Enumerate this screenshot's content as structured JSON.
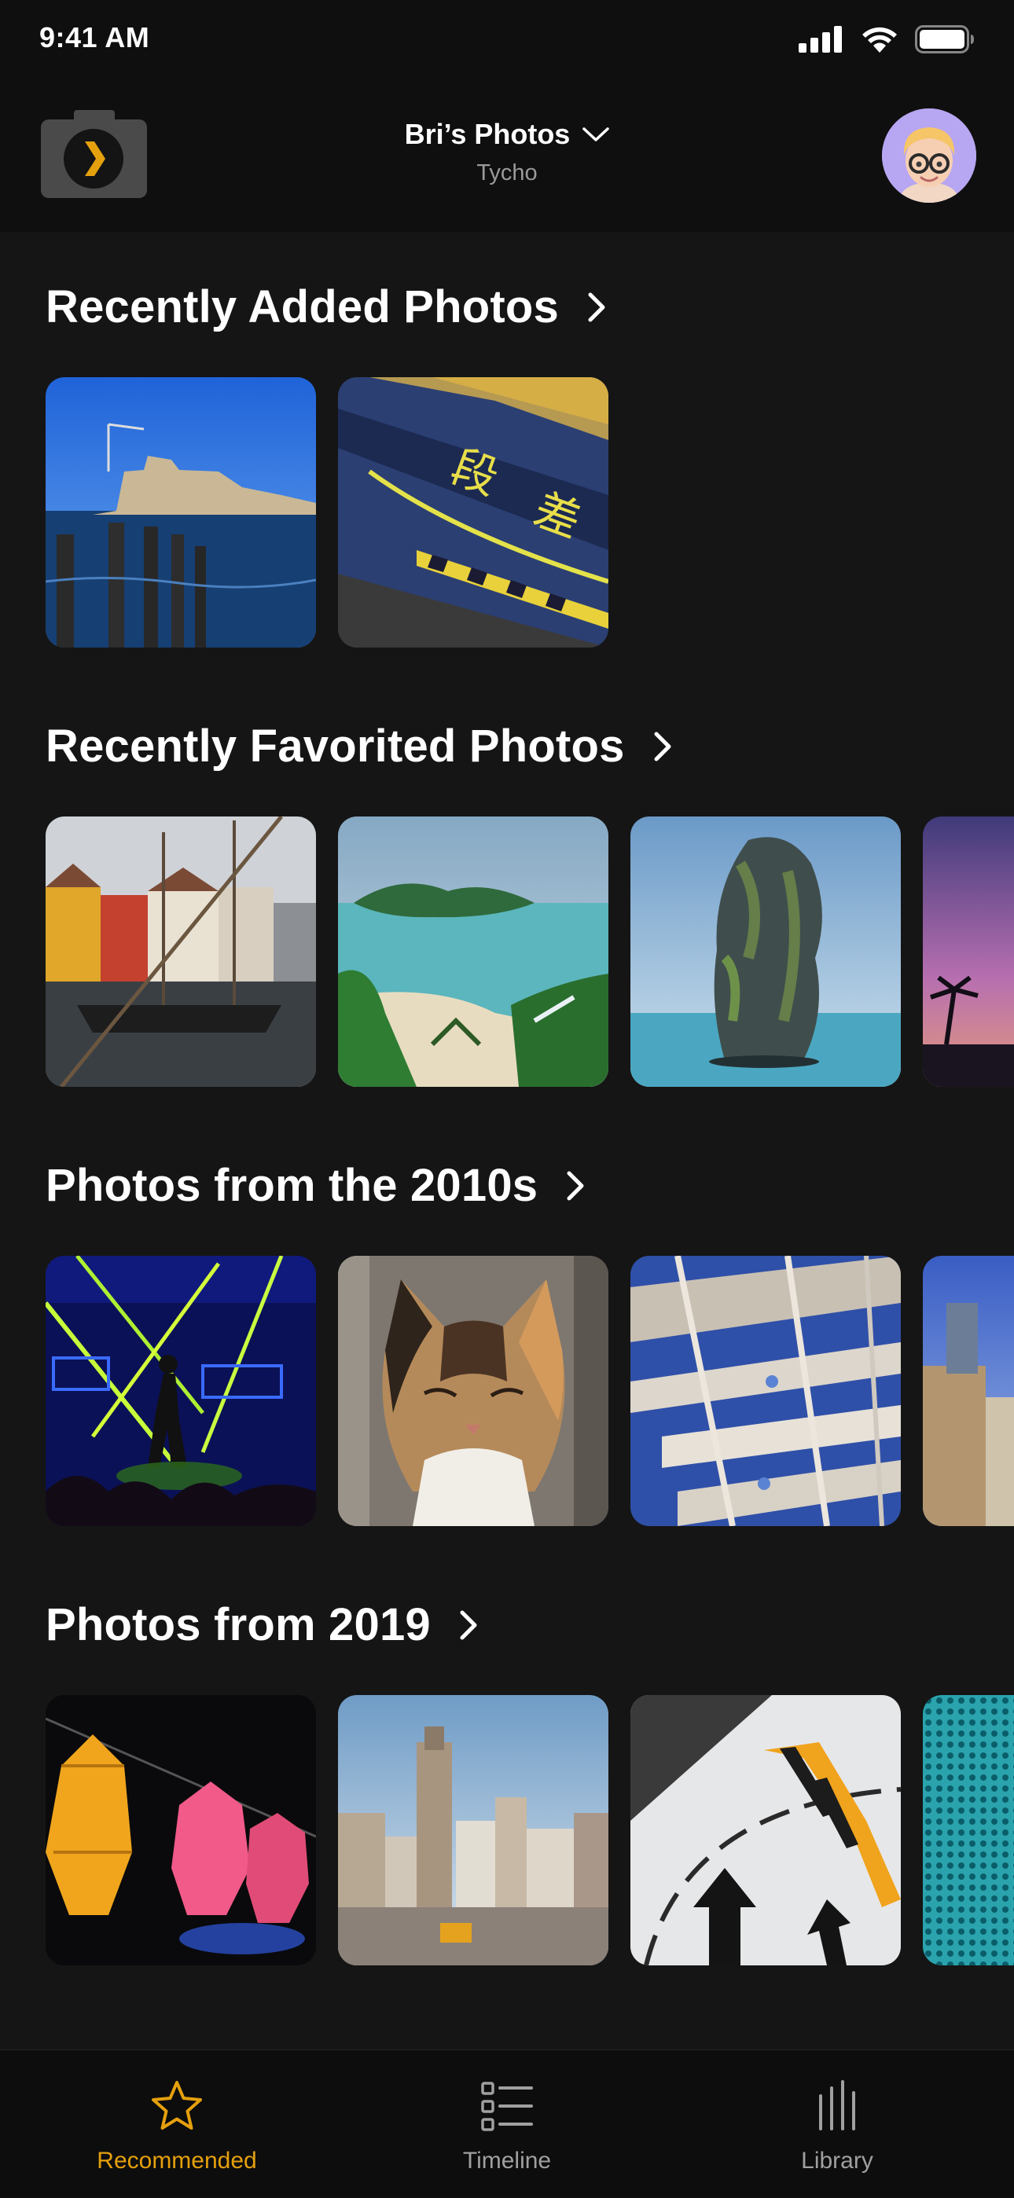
{
  "status_bar": {
    "time": "9:41 AM"
  },
  "header": {
    "title": "Bri’s Photos",
    "subtitle": "Tycho",
    "camera_icon": "plex-camera-icon",
    "avatar_icon": "memoji-avatar"
  },
  "sections": [
    {
      "title": "Recently Added Photos",
      "photos": [
        "harbor-buildings",
        "yellow-kanji-step"
      ]
    },
    {
      "title": "Recently Favorited Photos",
      "photos": [
        "nyhavn-boats",
        "tropical-island",
        "limestone-rock",
        "purple-sunset"
      ]
    },
    {
      "title": "Photos from the 2010s",
      "photos": [
        "nightclub-lasers",
        "calico-cat",
        "industrial-structure",
        "city-buildings"
      ]
    },
    {
      "title": "Photos from 2019",
      "photos": [
        "paper-lanterns",
        "city-skyline",
        "airplane-marking",
        "teal-pattern"
      ]
    }
  ],
  "tabs": [
    {
      "label": "Recommended",
      "icon": "star-icon",
      "active": true
    },
    {
      "label": "Timeline",
      "icon": "list-icon",
      "active": false
    },
    {
      "label": "Library",
      "icon": "library-icon",
      "active": false
    }
  ],
  "colors": {
    "accent": "#e5a00d",
    "background": "#151515",
    "header": "#0f0f0f"
  }
}
